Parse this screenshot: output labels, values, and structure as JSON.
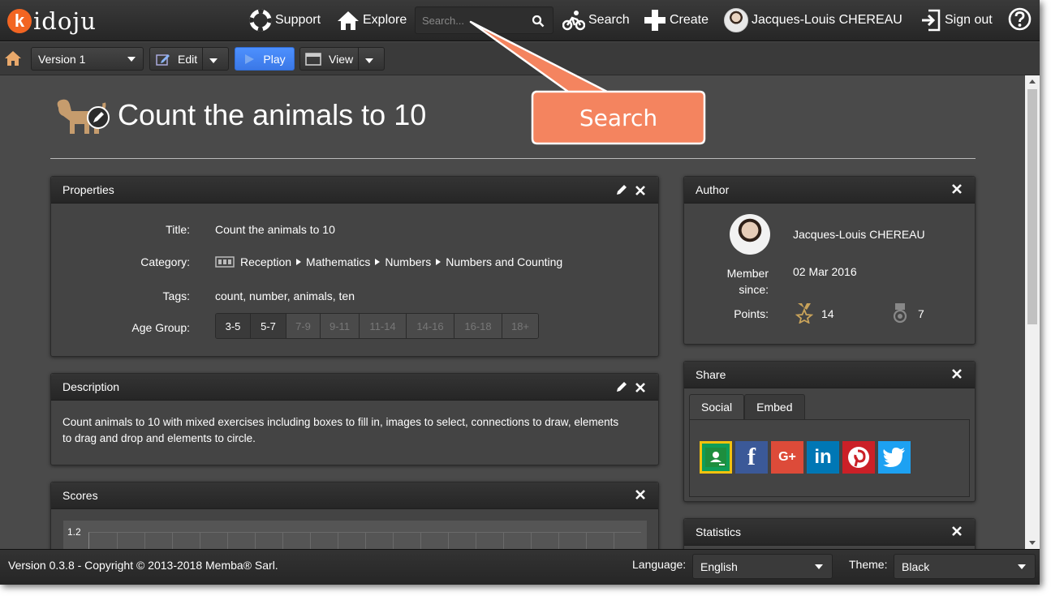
{
  "app": {
    "logo_first": "k",
    "logo_rest": "idoju"
  },
  "topnav": {
    "support": "Support",
    "explore": "Explore",
    "search_placeholder": "Search...",
    "search_link": "Search",
    "create": "Create",
    "user": "Jacques-Louis CHEREAU",
    "signout": "Sign out"
  },
  "toolbar": {
    "version": "Version 1",
    "edit": "Edit",
    "play": "Play",
    "view": "View"
  },
  "page": {
    "title": "Count the animals to 10"
  },
  "properties": {
    "header": "Properties",
    "title_label": "Title:",
    "title_value": "Count the animals to 10",
    "category_label": "Category:",
    "category": [
      "Reception",
      "Mathematics",
      "Numbers",
      "Numbers and Counting"
    ],
    "tags_label": "Tags:",
    "tags_value": "count, number, animals, ten",
    "age_label": "Age Group:",
    "age_groups": [
      {
        "label": "3-5",
        "selected": true
      },
      {
        "label": "5-7",
        "selected": true
      },
      {
        "label": "7-9",
        "selected": false
      },
      {
        "label": "9-11",
        "selected": false
      },
      {
        "label": "11-14",
        "selected": false
      },
      {
        "label": "14-16",
        "selected": false
      },
      {
        "label": "16-18",
        "selected": false
      },
      {
        "label": "18+",
        "selected": false
      }
    ]
  },
  "description": {
    "header": "Description",
    "line1": "Count animals to 10 with mixed exercises including boxes to fill in, images to select, connections to draw, elements",
    "line2": "to drag and drop and elements to circle."
  },
  "scores": {
    "header": "Scores",
    "y_tick": "1.2"
  },
  "author": {
    "header": "Author",
    "name": "Jacques-Louis CHEREAU",
    "member_label_1": "Member",
    "member_label_2": "since:",
    "member_since": "02 Mar 2016",
    "points_label": "Points:",
    "points_star": "14",
    "points_medal": "7"
  },
  "share": {
    "header": "Share",
    "tabs": [
      "Social",
      "Embed"
    ],
    "networks": [
      {
        "name": "google-classroom-icon",
        "color": "#0f9d58",
        "glyph": ""
      },
      {
        "name": "facebook-icon",
        "color": "#3b5998",
        "glyph": "f"
      },
      {
        "name": "google-plus-icon",
        "color": "#dd4b39",
        "glyph": "G+"
      },
      {
        "name": "linkedin-icon",
        "color": "#0077b5",
        "glyph": "in"
      },
      {
        "name": "pinterest-icon",
        "color": "#cb2027",
        "glyph": "P"
      },
      {
        "name": "twitter-icon",
        "color": "#1da1f2",
        "glyph": "t"
      }
    ]
  },
  "statistics": {
    "header": "Statistics"
  },
  "footer": {
    "copyright": "Version 0.3.8 - Copyright © 2013-2018 Memba® Sarl.",
    "language_label": "Language:",
    "language_value": "English",
    "theme_label": "Theme:",
    "theme_value": "Black"
  },
  "callout": {
    "text": "Search",
    "color": "#f4845f"
  }
}
